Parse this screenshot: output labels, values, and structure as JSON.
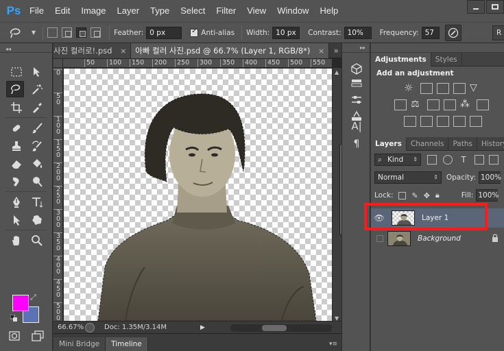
{
  "app": {
    "logo": "Ps"
  },
  "menu": [
    "File",
    "Edit",
    "Image",
    "Layer",
    "Type",
    "Select",
    "Filter",
    "View",
    "Window",
    "Help"
  ],
  "options": {
    "feather_label": "Feather:",
    "feather_value": "0 px",
    "antialias_label": "Anti-alias",
    "width_label": "Width:",
    "width_value": "10 px",
    "contrast_label": "Contrast:",
    "contrast_value": "10%",
    "frequency_label": "Frequency:",
    "frequency_value": "57",
    "refine_label": "R"
  },
  "document": {
    "tabs": [
      {
        "label": "사진 컬러로!.psd",
        "close": "×"
      },
      {
        "label": "아빠 컬러 사진.psd @ 66.7% (Layer 1, RGB/8*)",
        "close": "×"
      }
    ],
    "more_glyph": "»",
    "ruler_h": [
      "50",
      "100",
      "150",
      "200",
      "250",
      "300",
      "350",
      "400",
      "450",
      "500",
      "550"
    ],
    "ruler_v": [
      "0",
      "5 0",
      "1 0 0",
      "1 5 0",
      "2 0 0",
      "2 5 0",
      "3 0 0",
      "3 5 0",
      "4 0 0",
      "4 5 0",
      "5 0 0"
    ],
    "zoom": "66.67%",
    "doc_info": "Doc: 1.35M/3.14M",
    "status_arrow": "▶",
    "bottom_tabs": [
      "Mini Bridge",
      "Timeline"
    ]
  },
  "panels": {
    "adjustments_tabs": [
      "Adjustments",
      "Styles"
    ],
    "add_adjustment": "Add an adjustment",
    "layers_tabs": [
      "Layers",
      "Channels",
      "Paths",
      "History"
    ],
    "kind_label": "Kind",
    "blend_mode": "Normal",
    "opacity_label": "Opacity:",
    "opacity_value": "100%",
    "lock_label": "Lock:",
    "fill_label": "Fill:",
    "fill_value": "100%",
    "layers": [
      {
        "name": "Layer 1",
        "visible": true,
        "selected": true
      },
      {
        "name": "Background",
        "visible": false,
        "selected": false,
        "locked": true
      }
    ]
  },
  "colors": {
    "foreground": "#ff00ff",
    "background": "#5b73b3",
    "highlight": "#ff1a1a",
    "selected_layer": "#5a6577"
  }
}
